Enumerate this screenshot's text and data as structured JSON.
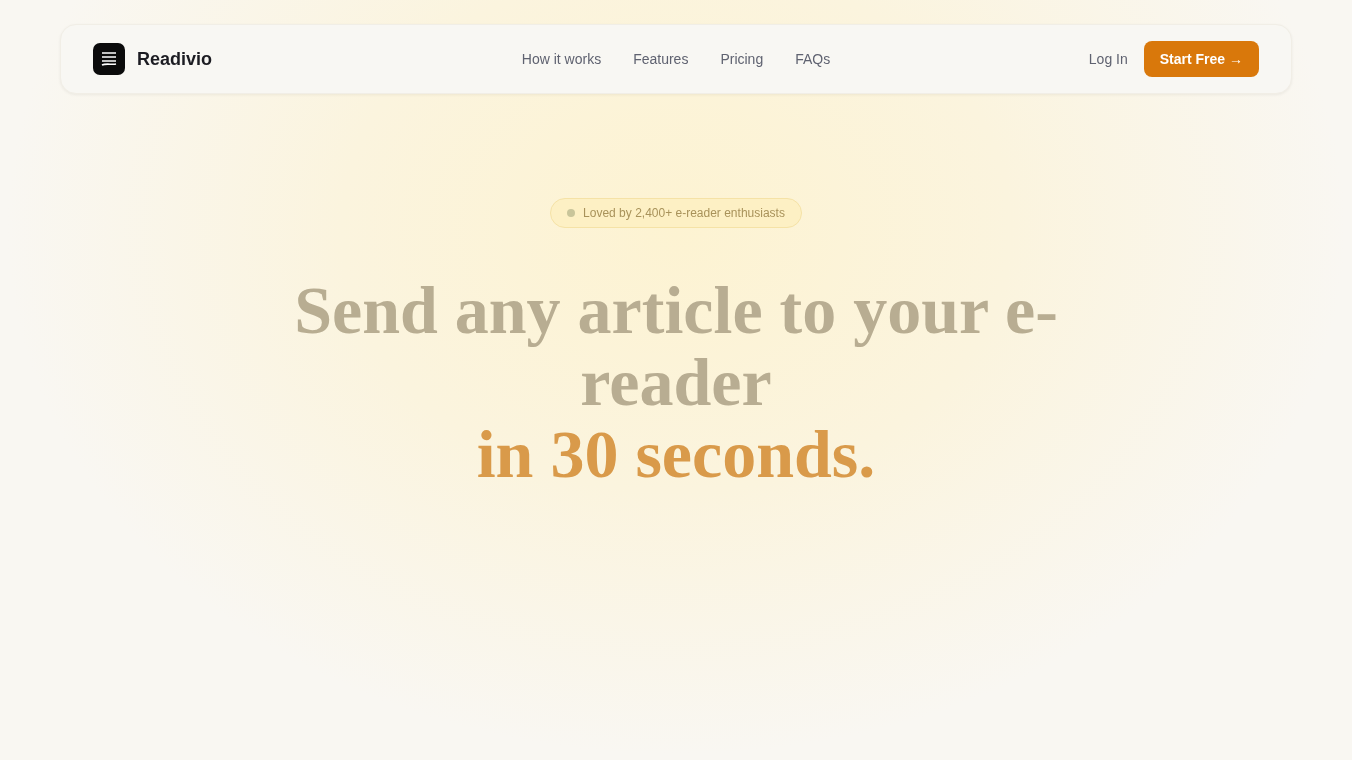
{
  "brand": {
    "name": "Readivio"
  },
  "nav": [
    {
      "label": "How it works"
    },
    {
      "label": "Features"
    },
    {
      "label": "Pricing"
    },
    {
      "label": "FAQs"
    }
  ],
  "login": "Log In",
  "cta": "Start Free →",
  "badge": {
    "text": "Loved by 2,400+ e-reader enthusiasts",
    "color": "#c9c59a"
  },
  "headline": {
    "line1": "Send any article to your e-reader",
    "line2": "in 30 seconds."
  }
}
